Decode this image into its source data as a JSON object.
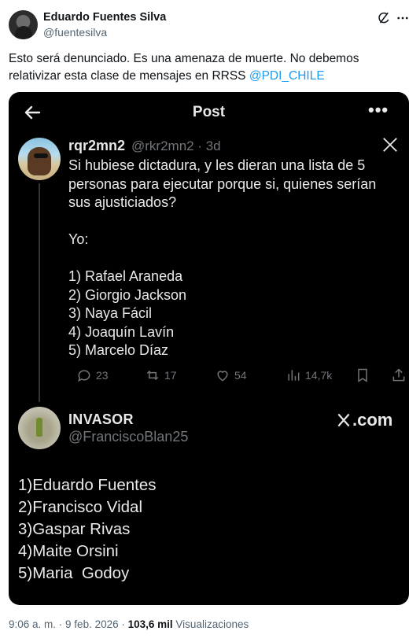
{
  "author": {
    "name": "Eduardo Fuentes Silva",
    "handle": "@fuentesilva"
  },
  "header_icons": [
    "grok-icon",
    "more-options-icon"
  ],
  "tweet": {
    "text": "Esto será denunciado. Es una amenaza de muerte. No debemos relativizar esta clase de mensajes en RRSS ",
    "mention": "@PDI_CHILE"
  },
  "screenshot": {
    "title": "Post",
    "more": "•••",
    "post1": {
      "name": "rqr2mn2",
      "meta": "@rkr2mn2 · 3d",
      "body": "Si hubiese dictadura, y les dieran una lista de 5 personas para ejecutar porque si, quienes serían sus ajusticiados?\n\nYo:\n\n1) Rafael Araneda\n2) Giorgio Jackson\n3) Naya Fácil\n4) Joaquín Lavín\n5) Marcelo Díaz",
      "stats": {
        "replies": "23",
        "reposts": "17",
        "likes": "54",
        "views": "14,7k"
      }
    },
    "post2": {
      "name": "INVASOR",
      "handle": "@FranciscoBlan25",
      "watermark": ".com",
      "list": [
        "1)Eduardo Fuentes",
        "2)Francisco Vidal",
        "3)Gaspar Rivas",
        "4)Maite Orsini",
        "5)Maria  Godoy"
      ]
    }
  },
  "footer": {
    "time": "9:06 a. m.",
    "date": "9 feb. 2026",
    "views_count": "103,6 mil",
    "views_label": "Visualizaciones",
    "separator": " · "
  },
  "colors": {
    "link": "#1d9bf0",
    "secondary_text": "#536471",
    "dark_bg": "#000000",
    "dark_text": "#e7e9ea",
    "dark_secondary": "#71767b"
  }
}
